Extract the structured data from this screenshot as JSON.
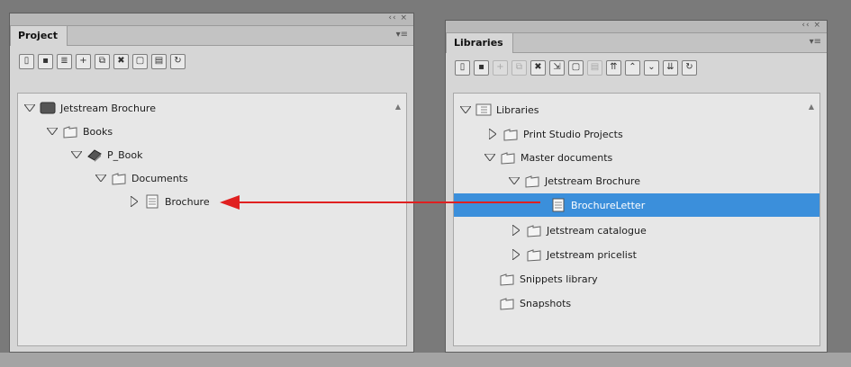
{
  "project": {
    "title": "Project",
    "controls": "‹‹  ×",
    "menu": "▾≡",
    "tree": [
      {
        "label": "Jetstream Brochure",
        "icon": "book-dark-icon",
        "expanded": true
      },
      {
        "label": "Books",
        "icon": "folder-icon",
        "expanded": true
      },
      {
        "label": "P_Book",
        "icon": "book-icon",
        "expanded": true
      },
      {
        "label": "Documents",
        "icon": "folder-icon",
        "expanded": true
      },
      {
        "label": "Brochure",
        "icon": "document-icon",
        "expanded": false
      }
    ]
  },
  "libraries": {
    "title": "Libraries",
    "controls": "‹‹  ×",
    "menu": "▾≡",
    "tree": [
      {
        "label": "Libraries",
        "icon": "library-icon",
        "expanded": true
      },
      {
        "label": "Print Studio Projects",
        "icon": "folder-icon",
        "expanded": false
      },
      {
        "label": "Master documents",
        "icon": "folder-icon",
        "expanded": true
      },
      {
        "label": "Jetstream Brochure",
        "icon": "folder-icon",
        "expanded": true
      },
      {
        "label": "BrochureLetter",
        "icon": "document-icon",
        "selected": true
      },
      {
        "label": "Jetstream catalogue",
        "icon": "folder-icon",
        "expanded": false
      },
      {
        "label": "Jetstream pricelist",
        "icon": "folder-icon",
        "expanded": false
      },
      {
        "label": "Snippets library",
        "icon": "folder-icon"
      },
      {
        "label": "Snapshots",
        "icon": "folder-icon"
      }
    ]
  },
  "colors": {
    "selection": "#3b8fdb",
    "arrow": "#e02020"
  }
}
